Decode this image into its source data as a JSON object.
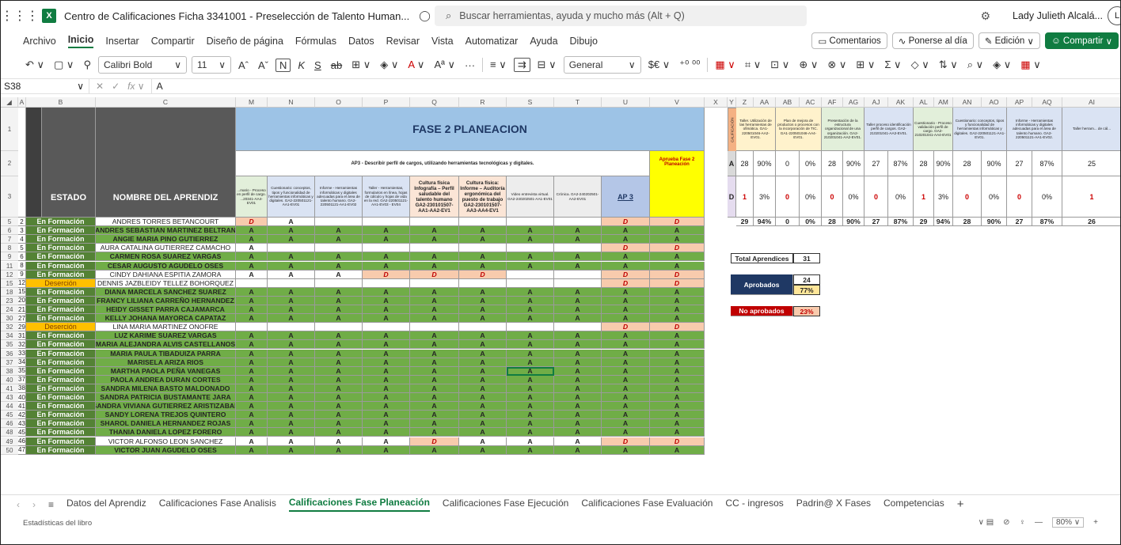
{
  "titlebar": {
    "waffle": "⋮⋮⋮",
    "app_logo": "X",
    "doc_title": "Centro de Calificaciones Ficha 3341001 - Preselección de Talento Human...",
    "search_placeholder": "Buscar herramientas, ayuda y mucho más (Alt + Q)",
    "user_name": "Lady Julieth Alcalá...",
    "avatar": "L"
  },
  "menu": [
    "Archivo",
    "Inicio",
    "Insertar",
    "Compartir",
    "Diseño de página",
    "Fórmulas",
    "Datos",
    "Revisar",
    "Vista",
    "Automatizar",
    "Ayuda",
    "Dibujo"
  ],
  "menu_right": {
    "comments": "Comentarios",
    "catchup": "Ponerse al día",
    "edit": "Edición",
    "share": "Compartir"
  },
  "toolbar": {
    "font": "Calibri Bold",
    "size": "11",
    "format": "General"
  },
  "formula": {
    "namebox": "S38",
    "value": "A"
  },
  "cols": [
    "A",
    "B",
    "C",
    "M",
    "N",
    "O",
    "P",
    "Q",
    "R",
    "S",
    "T",
    "U",
    "V",
    "X",
    "Y",
    "Z",
    "AA",
    "AB",
    "AC",
    "AF",
    "AG",
    "AJ",
    "AK",
    "AL",
    "AM",
    "AN",
    "AO",
    "AP",
    "AQ",
    "AI"
  ],
  "header": {
    "estado": "ESTADO",
    "nombre": "NOMBRE DEL APRENDIZ",
    "fase": "FASE 2 PLANEACION",
    "ap3_desc": "AP3 - Describir perfil de cargos, utilizando herramientas tecnológicas y digitales.",
    "ap3": "AP 3",
    "aprueba": "Aprueba Fase 2 Planeación",
    "sub": [
      "...mario - Proceso en perfil de cargo. ...20341-AA4-EV01",
      "Cuestionario: conceptos, tipos y funcionalidad de herramientas informáticas y digitales. GA2-220501121-AA1-EV01",
      "Informe - Herramientas informáticas y digitales adecuadas para el área de talento humano. GA2-220501121-AA1-EV02",
      "Taller - Herramientas, formularios en línea, hojas de cálculo y hojas de vida en la red. GA2-220501121-AA1-EV03 - EV04",
      "Cultura física Infografía – Perfil saludable del talento humano GA2-230101507-AA1-AA2-EV1",
      "Cultura física: Informe – Auditoría ergonómica del puesto de trabajo GA2-230101507-AA3-AA4-EV1",
      "Video entrevista virtual. GA2-240202501-AA1-EV01",
      "Crónica. GA2-240202501-AA2-EV01"
    ]
  },
  "summary_header": {
    "calif": "CALIFICACIÓN",
    "cols": [
      "Taller. Utilización de las herramientas de ofimática. GA1-220501046-AA2-EV01.",
      "Plan de mejora de productos o procesos con la incorporación de TIC. GA1-220501046-AA4-EV01.",
      "Presentación de la estructura organizacional de una organización. GA2-210201041-AA2-EV01.",
      "Taller proceso identificación perfil de cargos. GA2-210201041-AA3-EV01.",
      "Cuestionario - Proceso validación perfil de cargo. GA2-210201041-AA4-EV01",
      "Cuestionario: conceptos, tipos y funcionalidad de herramientas informáticas y digitales. GA2-220501121-AA1-EV01.",
      "Informe - Herramientas informáticas y digitales adecuadas para el área de talento humano. GA2-220501121-AA1-EV02.",
      "Taller herram... de cál..."
    ],
    "rowA": {
      "label": "A",
      "vals": [
        "28",
        "90%",
        "0",
        "0%",
        "28",
        "90%",
        "27",
        "87%",
        "28",
        "90%",
        "28",
        "90%",
        "27",
        "87%",
        "25"
      ]
    },
    "rowD": {
      "label": "D",
      "vals": [
        "1",
        "3%",
        "0",
        "0%",
        "0",
        "0%",
        "0",
        "0%",
        "1",
        "3%",
        "0",
        "0%",
        "0",
        "0%",
        "1"
      ]
    },
    "totals": [
      "29",
      "94%",
      "0",
      "0%",
      "28",
      "90%",
      "27",
      "87%",
      "29",
      "94%",
      "28",
      "90%",
      "27",
      "87%",
      "26"
    ]
  },
  "stats": {
    "total_label": "Total Aprendices",
    "total": "31",
    "aprob_label": "Aprobados",
    "aprob": "24",
    "aprob_pct": "77%",
    "noaprob_label": "No aprobados",
    "noaprob_pct": "23%"
  },
  "rows": [
    {
      "r": "5",
      "n": "2",
      "estado": "En Formación",
      "nombre": "ANDRES  TORRES BETANCOURT",
      "v": [
        "D",
        "A",
        "",
        "",
        "",
        "",
        "",
        "",
        "D",
        "D"
      ]
    },
    {
      "r": "6",
      "n": "3",
      "estado": "En Formación",
      "nombre": "ANDRES SEBASTIAN MARTINEZ BELTRAN",
      "v": [
        "A",
        "A",
        "A",
        "A",
        "A",
        "A",
        "A",
        "A",
        "A",
        "A"
      ]
    },
    {
      "r": "7",
      "n": "4",
      "estado": "En Formación",
      "nombre": "ANGIE MARIA PINO GUTIERREZ",
      "v": [
        "A",
        "A",
        "A",
        "A",
        "A",
        "A",
        "A",
        "A",
        "A",
        "A"
      ]
    },
    {
      "r": "8",
      "n": "5",
      "estado": "En Formación",
      "nombre": "AURA CATALINA GUTIERREZ CAMACHO",
      "v": [
        "A",
        "",
        "",
        "",
        "",
        "",
        "",
        "",
        "D",
        "D"
      ]
    },
    {
      "r": "9",
      "n": "6",
      "estado": "En Formación",
      "nombre": "CARMEN ROSA SUAREZ VARGAS",
      "v": [
        "A",
        "A",
        "A",
        "A",
        "A",
        "A",
        "A",
        "A",
        "A",
        "A"
      ]
    },
    {
      "r": "11",
      "n": "8",
      "estado": "En Formación",
      "nombre": "CESAR AUGUSTO AGUDELO OSES",
      "v": [
        "A",
        "A",
        "A",
        "A",
        "A",
        "A",
        "A",
        "A",
        "A",
        "A"
      ]
    },
    {
      "r": "12",
      "n": "9",
      "estado": "En Formación",
      "nombre": "CINDY DAHIANA ESPITIA ZAMORA",
      "v": [
        "A",
        "A",
        "A",
        "D",
        "D",
        "D",
        "",
        "",
        "D",
        "D"
      ]
    },
    {
      "r": "15",
      "n": "12",
      "estado": "Deserción",
      "nombre": "DENNIS JAZBLEIDY TELLEZ BOHORQUEZ",
      "v": [
        "",
        "",
        "",
        "",
        "",
        "",
        "",
        "",
        "D",
        "D"
      ]
    },
    {
      "r": "18",
      "n": "15",
      "estado": "En Formación",
      "nombre": "DIANA MARCELA SANCHEZ SUAREZ",
      "v": [
        "A",
        "A",
        "A",
        "A",
        "A",
        "A",
        "A",
        "A",
        "A",
        "A"
      ]
    },
    {
      "r": "23",
      "n": "20",
      "estado": "En Formación",
      "nombre": "FRANCY LILIANA CARREÑO HERNANDEZ",
      "v": [
        "A",
        "A",
        "A",
        "A",
        "A",
        "A",
        "A",
        "A",
        "A",
        "A"
      ]
    },
    {
      "r": "24",
      "n": "21",
      "estado": "En Formación",
      "nombre": "HEIDY GISSET PARRA CAJAMARCA",
      "v": [
        "A",
        "A",
        "A",
        "A",
        "A",
        "A",
        "A",
        "A",
        "A",
        "A"
      ]
    },
    {
      "r": "30",
      "n": "27",
      "estado": "En Formación",
      "nombre": "KELLY JOHANA MAYORCA CAPATAZ",
      "v": [
        "A",
        "A",
        "A",
        "A",
        "A",
        "A",
        "A",
        "A",
        "A",
        "A"
      ]
    },
    {
      "r": "32",
      "n": "29",
      "estado": "Deserción",
      "nombre": "LINA MARIA MARTINEZ ONOFRE",
      "v": [
        "",
        "",
        "",
        "",
        "",
        "",
        "",
        "",
        "D",
        "D"
      ]
    },
    {
      "r": "34",
      "n": "31",
      "estado": "En Formación",
      "nombre": "LUZ KARIME SUAREZ VARGAS",
      "v": [
        "A",
        "A",
        "A",
        "A",
        "A",
        "A",
        "A",
        "A",
        "A",
        "A"
      ]
    },
    {
      "r": "35",
      "n": "32",
      "estado": "En Formación",
      "nombre": "MARIA ALEJANDRA ALVIS CASTELLANOS",
      "v": [
        "A",
        "A",
        "A",
        "A",
        "A",
        "A",
        "A",
        "A",
        "A",
        "A"
      ]
    },
    {
      "r": "36",
      "n": "33",
      "estado": "En Formación",
      "nombre": "MARIA PAULA TIBADUIZA PARRA",
      "v": [
        "A",
        "A",
        "A",
        "A",
        "A",
        "A",
        "A",
        "A",
        "A",
        "A"
      ]
    },
    {
      "r": "37",
      "n": "34",
      "estado": "En Formación",
      "nombre": "MARISELA  ARIZA RIOS",
      "v": [
        "A",
        "A",
        "A",
        "A",
        "A",
        "A",
        "A",
        "A",
        "A",
        "A"
      ]
    },
    {
      "r": "38",
      "n": "35",
      "estado": "En Formación",
      "nombre": "MARTHA PAOLA PEÑA VANEGAS",
      "v": [
        "A",
        "A",
        "A",
        "A",
        "A",
        "A",
        "A",
        "A",
        "A",
        "A"
      ]
    },
    {
      "r": "40",
      "n": "37",
      "estado": "En Formación",
      "nombre": "PAOLA ANDREA DURAN CORTES",
      "v": [
        "A",
        "A",
        "A",
        "A",
        "A",
        "A",
        "A",
        "A",
        "A",
        "A"
      ]
    },
    {
      "r": "41",
      "n": "38",
      "estado": "En Formación",
      "nombre": "SANDRA MILENA BASTO MALDONADO",
      "v": [
        "A",
        "A",
        "A",
        "A",
        "A",
        "A",
        "A",
        "A",
        "A",
        "A"
      ]
    },
    {
      "r": "43",
      "n": "40",
      "estado": "En Formación",
      "nombre": "SANDRA PATRICIA BUSTAMANTE JARA",
      "v": [
        "A",
        "A",
        "A",
        "A",
        "A",
        "A",
        "A",
        "A",
        "A",
        "A"
      ]
    },
    {
      "r": "44",
      "n": "41",
      "estado": "En Formación",
      "nombre": "SANDRA VIVIANA GUTIERREZ ARISTIZABAL",
      "v": [
        "A",
        "A",
        "A",
        "A",
        "A",
        "A",
        "A",
        "A",
        "A",
        "A"
      ]
    },
    {
      "r": "45",
      "n": "42",
      "estado": "En Formación",
      "nombre": "SANDY LORENA TREJOS QUINTERO",
      "v": [
        "A",
        "A",
        "A",
        "A",
        "A",
        "A",
        "A",
        "A",
        "A",
        "A"
      ]
    },
    {
      "r": "46",
      "n": "43",
      "estado": "En Formación",
      "nombre": "SHAROL DANIELA HERNANDEZ ROJAS",
      "v": [
        "A",
        "A",
        "A",
        "A",
        "A",
        "A",
        "A",
        "A",
        "A",
        "A"
      ]
    },
    {
      "r": "48",
      "n": "45",
      "estado": "En Formación",
      "nombre": "THANIA DANIELA LOPEZ FORERO",
      "v": [
        "A",
        "A",
        "A",
        "A",
        "A",
        "A",
        "A",
        "A",
        "A",
        "A"
      ]
    },
    {
      "r": "49",
      "n": "46",
      "estado": "En Formación",
      "nombre": "VICTOR ALFONSO LEON SANCHEZ",
      "v": [
        "A",
        "A",
        "A",
        "A",
        "D",
        "A",
        "A",
        "A",
        "D",
        "D"
      ]
    },
    {
      "r": "50",
      "n": "47",
      "estado": "En Formación",
      "nombre": "VICTOR JUAN AGUDELO OSES",
      "v": [
        "A",
        "A",
        "A",
        "A",
        "A",
        "A",
        "A",
        "A",
        "A",
        "A"
      ]
    }
  ],
  "tabs": [
    "Datos del Aprendiz",
    "Calificaciones Fase Analisis",
    "Calificaciones Fase Planeación",
    "Calificaciones Fase Ejecución",
    "Calificaciones Fase Evaluación",
    "CC - ingresos",
    "Padrin@ X Fases",
    "Competencias"
  ],
  "status": {
    "left": "Estadísticas del libro",
    "zoom": "80%"
  }
}
